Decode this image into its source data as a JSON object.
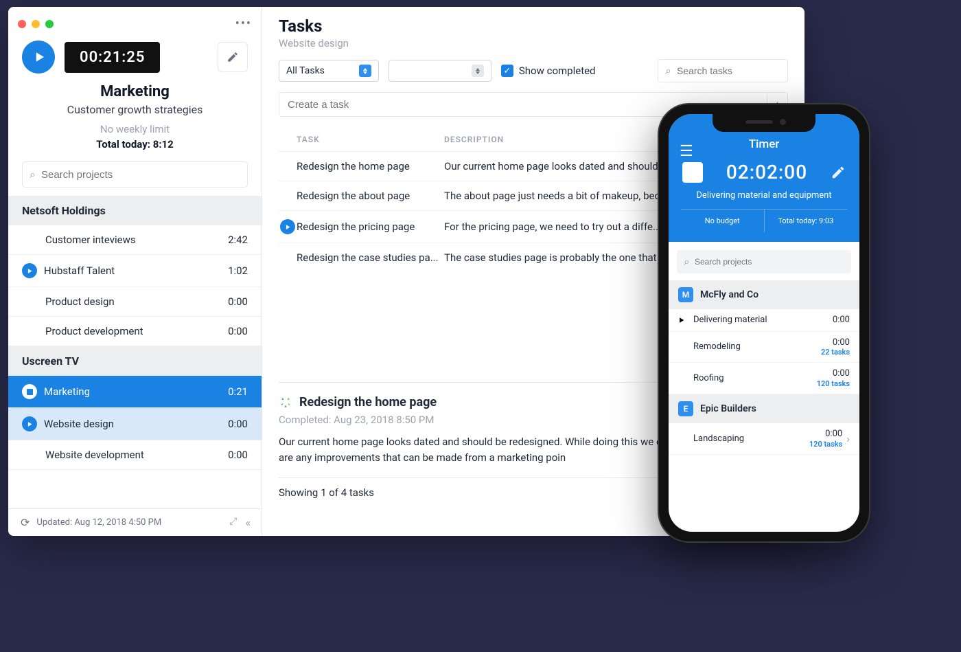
{
  "desktop": {
    "timer": "00:21:25",
    "project_title": "Marketing",
    "project_sub": "Customer growth strategies",
    "weekly_limit": "No weekly limit",
    "total_today": "Total today: 8:12",
    "search_placeholder": "Search projects",
    "footer_updated": "Updated: Aug 12, 2018 4:50 PM",
    "groups": [
      {
        "name": "Netsoft Holdings",
        "projects": [
          {
            "name": "Customer inteviews",
            "time": "2:42",
            "state": "none"
          },
          {
            "name": "Hubstaff Talent",
            "time": "1:02",
            "state": "play"
          },
          {
            "name": "Product design",
            "time": "0:00",
            "state": "none"
          },
          {
            "name": "Product development",
            "time": "0:00",
            "state": "none"
          }
        ]
      },
      {
        "name": "Uscreen TV",
        "projects": [
          {
            "name": "Marketing",
            "time": "0:21",
            "state": "selected"
          },
          {
            "name": "Website design",
            "time": "0:00",
            "state": "secondary"
          },
          {
            "name": "Website development",
            "time": "0:00",
            "state": "none"
          }
        ]
      }
    ]
  },
  "tasks": {
    "title": "Tasks",
    "subtitle": "Website design",
    "filter_value": "All Tasks",
    "show_completed_label": "Show completed",
    "search_placeholder": "Search tasks",
    "create_placeholder": "Create a task",
    "col_task": "TASK",
    "col_desc": "DESCRIPTION",
    "rows": [
      {
        "name": "Redesign the home page",
        "desc": "Our current home page looks dated and should..."
      },
      {
        "name": "Redesign the about page",
        "desc": "The about page just needs a bit of makeup, bec..."
      },
      {
        "name": "Redesign the pricing page",
        "desc": "For the pricing page, we need to try out a diffe..."
      },
      {
        "name": "Redesign the case studies pa...",
        "desc": "The case studies page is probably the one that ..."
      }
    ],
    "detail": {
      "title": "Redesign the home page",
      "completed": "Completed: Aug 23, 2018 8:50 PM",
      "body": "Our current home page looks dated and should be redesigned. While doing this we can section and see if there are any improvements that can be made from a marketing poin"
    },
    "showing": "Showing 1 of 4 tasks"
  },
  "phone": {
    "title": "Timer",
    "timer": "02:02:00",
    "current_task": "Delivering material and equipment",
    "no_budget": "No budget",
    "total_today": "Total today: 9:03",
    "search_placeholder": "Search projects",
    "groups": [
      {
        "name": "McFly and Co",
        "avatar": "M",
        "items": [
          {
            "name": "Delivering material",
            "time": "0:00",
            "tasks": "",
            "play": true
          },
          {
            "name": "Remodeling",
            "time": "0:00",
            "tasks": "22 tasks"
          },
          {
            "name": "Roofing",
            "time": "0:00",
            "tasks": "120 tasks"
          }
        ]
      },
      {
        "name": "Epic Builders",
        "avatar": "E",
        "items": [
          {
            "name": "Landscaping",
            "time": "0:00",
            "tasks": "120 tasks",
            "chevron": true
          }
        ]
      }
    ]
  }
}
